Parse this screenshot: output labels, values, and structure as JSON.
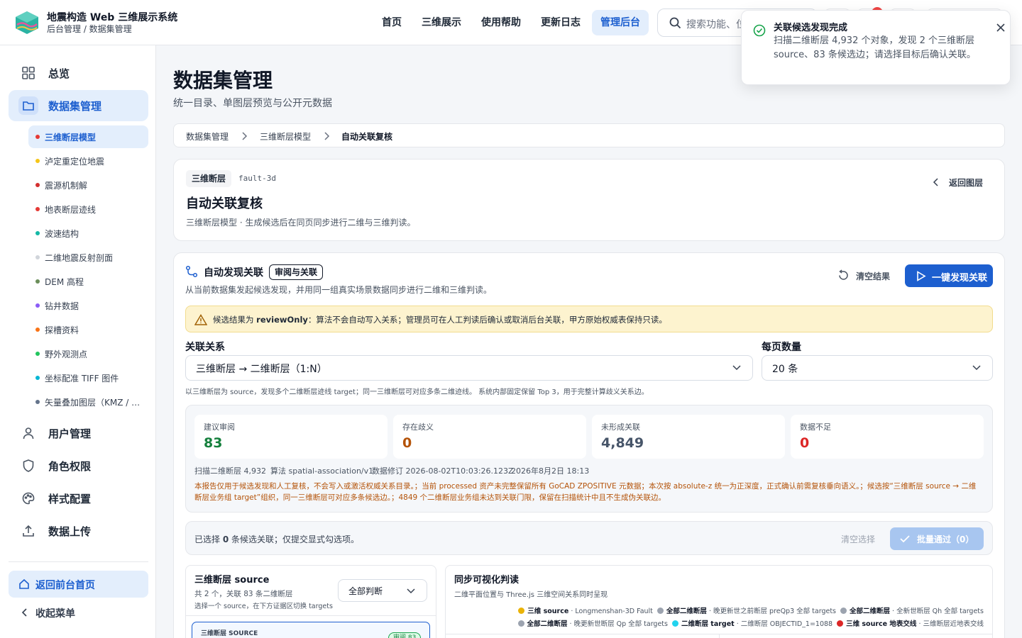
{
  "header": {
    "brand_title": "地震构造 Web 三维展示系统",
    "brand_subtitle": "后台管理 / 数据集管理",
    "nav": [
      "首页",
      "三维展示",
      "使用帮助",
      "更新日志",
      "管理后台"
    ],
    "search_placeholder": "搜索功能、位置…",
    "notification_icon": "bell-icon",
    "accent_color": "#1d5fcf"
  },
  "toast": {
    "title": "关联候选发现完成",
    "message": "扫描二维断层 4,932 个对象，发现 2 个三维断层 source、83 条候选边；请选择目标后确认关联。"
  },
  "sidebar": {
    "items": [
      {
        "label": "总览",
        "icon": "grid-icon"
      },
      {
        "label": "数据集管理",
        "icon": "folder-icon"
      },
      {
        "label": "用户管理",
        "icon": "user-icon"
      },
      {
        "label": "角色权限",
        "icon": "shield-icon"
      },
      {
        "label": "样式配置",
        "icon": "palette-icon"
      },
      {
        "label": "数据上传",
        "icon": "upload-icon"
      }
    ],
    "sub_items": [
      {
        "label": "三维断层模型",
        "color": "#e53935"
      },
      {
        "label": "泸定重定位地震",
        "color": "#f5c518"
      },
      {
        "label": "震源机制解",
        "color": "#d32f2f"
      },
      {
        "label": "地表断层迹线",
        "color": "#e53935"
      },
      {
        "label": "波速结构",
        "color": "#14b8a6"
      },
      {
        "label": "二维地震反射剖面",
        "color": "#d1d5db"
      },
      {
        "label": "DEM 高程",
        "color": "#6b8e5a"
      },
      {
        "label": "钻井数据",
        "color": "#8b5cf6"
      },
      {
        "label": "探槽资料",
        "color": "#f97316"
      },
      {
        "label": "野外观测点",
        "color": "#22c55e"
      },
      {
        "label": "坐标配准 TIFF 图件",
        "color": "#06b6d4"
      },
      {
        "label": "矢量叠加图层（KMZ / Shapefile）",
        "color": "#64748b"
      }
    ],
    "back_home": "返回前台首页",
    "collapse": "收起菜单"
  },
  "page": {
    "title": "数据集管理",
    "subtitle": "统一目录、单图层预览与公开元数据",
    "breadcrumb": [
      "数据集管理",
      "三维断层模型",
      "自动关联复核"
    ]
  },
  "dataset_card": {
    "tag": "三维断层",
    "code": "fault-3d",
    "title": "自动关联复核",
    "desc": "三维断层模型 · 生成候选后在同页同步进行二维与三维判读。",
    "back_label": "返回图层"
  },
  "discovery": {
    "title": "自动发现关联",
    "badge": "审阅与关联",
    "desc": "从当前数据集发起候选发现，并用同一组真实场景数据同步进行二维和三维判读。",
    "clear_label": "清空结果",
    "run_label": "一键发现关联",
    "warning_prefix": "候选结果为",
    "warning_key": "reviewOnly",
    "warning_rest": "：算法不会自动写入关系；管理员可在人工判读后确认或取消后台关联，甲方原始权威表保持只读。",
    "relation_label": "关联关系",
    "relation_value": "三维断层 → 二维断层（1:N）",
    "page_size_label": "每页数量",
    "page_size_value": "20 条",
    "relation_hint": "以三维断层为 source，发现多个二维断层迹线 target；同一三维断层可对应多条二维迹线。 系统内部固定保留 Top 3，用于完整计算歧义关系边。"
  },
  "stats": {
    "cards": [
      {
        "label": "建议审阅",
        "value": "83",
        "color": "#15803d"
      },
      {
        "label": "存在歧义",
        "value": "0",
        "color": "#b45309"
      },
      {
        "label": "未形成关联",
        "value": "4,849",
        "color": "#475569"
      },
      {
        "label": "数据不足",
        "value": "0",
        "color": "#dc2626"
      }
    ],
    "meta": [
      "扫描二维断层 4,932",
      "算法 spatial-association/v1",
      "数据修订 2026-08-02T10:03:26.123Z",
      "2026年8月2日 18:13"
    ],
    "note": "本报告仅用于候选发现和人工复核，不会写入或激活权威关系目录。；当前 processed 资产未完整保留所有 GoCAD ZPOSITIVE 元数据；本次按 absolute-z 统一为正深度，正式确认前需复核垂向语义。；候选按“三维断层 source → 二维断层业务组 target”组织，同一三维断层可对应多条候选边。；4849 个二维断层业务组未达到关联门限，保留在扫描统计中且不生成伪关联边。"
  },
  "selection": {
    "prefix": "已选择",
    "count": "0",
    "suffix": "条候选关联；仅提交显式勾选项。",
    "clear_label": "清空选择",
    "approve_label": "批量通过（0）"
  },
  "source_panel": {
    "title": "三维断层 source",
    "summary": "共 2 个，关联 83 条二维断层",
    "hint": "选择一个 source，在下方证据区切换 targets",
    "filter_value": "全部判断",
    "first_item_label": "三维断层 SOURCE",
    "first_item_badge": "审阅 83"
  },
  "viz_panel": {
    "title": "同步可视化判读",
    "subtitle": "二维平面位置与 Three.js 三维空间关系同时呈现",
    "legend": [
      {
        "bold": "三维 source",
        "text": "Longmenshan-3D Fault",
        "color": "#eab308"
      },
      {
        "bold": "全部二维断层",
        "text": "晚更新世之前断层 preQp3 全部 targets",
        "color": "#9ca3af"
      },
      {
        "bold": "全部二维断层",
        "text": "全新世断层 Qh 全部 targets",
        "color": "#9ca3af"
      },
      {
        "bold": "全部二维断层",
        "text": "晚更新世断层 Qp 全部 targets",
        "color": "#9ca3af"
      },
      {
        "bold": "二维断层 target",
        "text": "二维断层 OBJECTID_1=1088",
        "color": "#22d3ee"
      },
      {
        "bold": "三维 source 地表交线",
        "text": "三维断层近地表交线",
        "color": "#dc2626"
      }
    ]
  }
}
